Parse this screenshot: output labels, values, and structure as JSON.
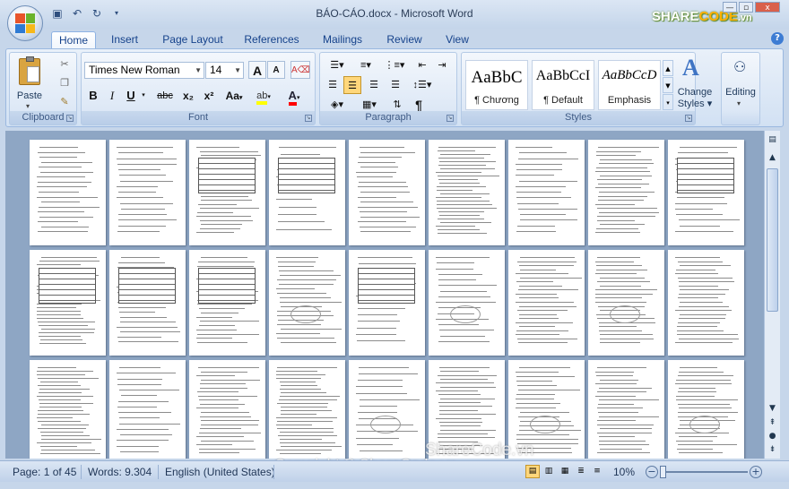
{
  "window": {
    "title": "BÁO-CÁO.docx - Microsoft Word",
    "minimize": "—",
    "maximize": "▫",
    "close": "x"
  },
  "brand": {
    "logo_text_a": "SHARE",
    "logo_text_b": "CODE",
    "logo_text_c": ".vn"
  },
  "qat": {
    "save_icon": "save-icon",
    "undo_icon": "undo-icon",
    "redo_icon": "redo-icon",
    "customize_icon": "customize-qat-icon"
  },
  "tabs": [
    {
      "label": "Home"
    },
    {
      "label": "Insert"
    },
    {
      "label": "Page Layout"
    },
    {
      "label": "References"
    },
    {
      "label": "Mailings"
    },
    {
      "label": "Review"
    },
    {
      "label": "View"
    }
  ],
  "active_tab": "Home",
  "help": "?",
  "clipboard": {
    "paste": "Paste",
    "group": "Clipboard"
  },
  "font": {
    "name": "Times New Roman",
    "size": "14",
    "bold": "B",
    "italic": "I",
    "underline": "U",
    "strike": "abc",
    "sub": "x₂",
    "sup": "x²",
    "case": "Aa",
    "grow": "A",
    "shrink": "A",
    "group": "Font"
  },
  "paragraph": {
    "group": "Paragraph",
    "pilcrow": "¶"
  },
  "styles": {
    "items": [
      {
        "sample": "AaBbC",
        "name": "¶ Chương"
      },
      {
        "sample": "AaBbCcI",
        "name": "¶ Default"
      },
      {
        "sample": "AaBbCcD",
        "name": "Emphasis"
      }
    ],
    "change_a": "Change",
    "change_b": "Styles",
    "group": "Styles"
  },
  "editing": {
    "label": "Editing"
  },
  "status": {
    "page": "Page: 1 of 45",
    "words": "Words: 9.304",
    "language": "English (United States)",
    "zoom": "10%"
  },
  "watermark": {
    "center": "ShareCode.vn",
    "copyright": "Copyright © ShareCode.vn"
  },
  "colors": {
    "accent": "#15428b",
    "highlight": "#ffff00",
    "font_color": "#ff0000",
    "ribbon": "#dde8f6"
  }
}
